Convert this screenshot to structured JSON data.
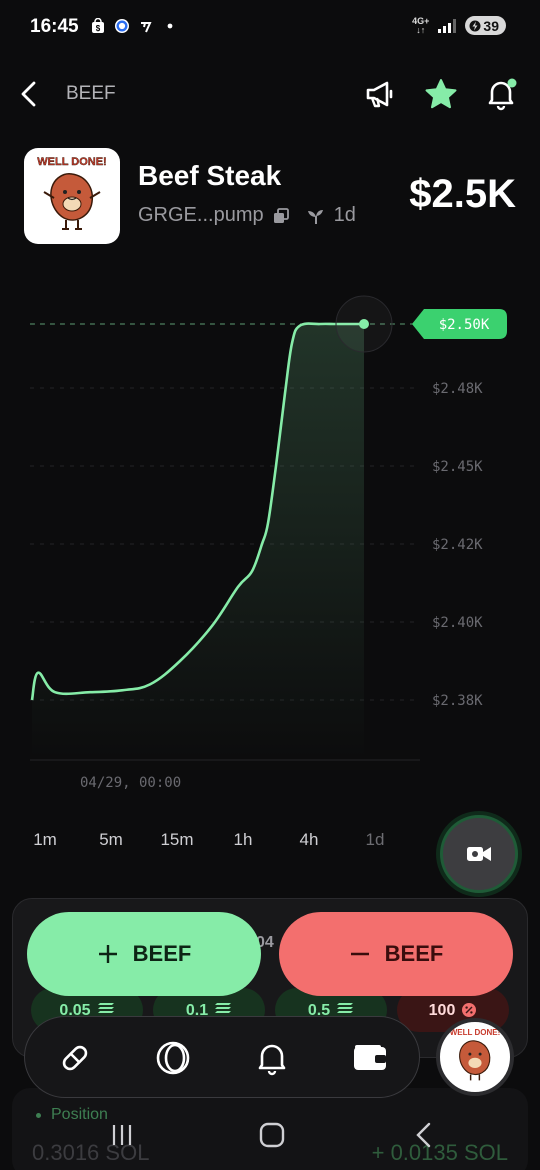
{
  "status_bar": {
    "time": "16:45",
    "network": "4G+",
    "battery": "39"
  },
  "header": {
    "ticker": "BEEF"
  },
  "token": {
    "name": "Beef Steak",
    "address": "GRGE...pump",
    "age": "1d",
    "price": "$2.5K",
    "logo_caption": "WELL DONE!"
  },
  "chart_data": {
    "type": "line",
    "y_ticks": [
      "$2.50K",
      "$2.48K",
      "$2.45K",
      "$2.42K",
      "$2.40K",
      "$2.38K"
    ],
    "x_ticks": [
      "04/29, 00:00"
    ],
    "current_label": "$2.50K",
    "x": [
      "t01",
      "t02",
      "t03",
      "t04",
      "t05",
      "t06",
      "t07",
      "t08",
      "t09",
      "t10",
      "t11",
      "t12",
      "t13",
      "t14",
      "t15",
      "t16",
      "t17",
      "t18",
      "t19",
      "t20",
      "t21",
      "t22"
    ],
    "values": [
      2380,
      2387,
      2382,
      2382,
      2382.5,
      2384,
      2390,
      2399,
      2409,
      2413,
      2420,
      2428,
      2450,
      2478,
      2494,
      2499.5,
      2500,
      2500,
      2500,
      2500,
      2500,
      2500
    ],
    "ylim": [
      2365,
      2510
    ],
    "color": "#86eca8"
  },
  "timeframes": [
    {
      "label": "1m"
    },
    {
      "label": "5m"
    },
    {
      "label": "15m"
    },
    {
      "label": "1h"
    },
    {
      "label": "4h"
    },
    {
      "label": "1d"
    }
  ],
  "trade": {
    "buy_label": "BEEF",
    "sell_label": "BEEF",
    "peek_text": "04",
    "buy_amounts": [
      "0.05",
      "0.1",
      "0.5"
    ],
    "sell_amount": "100"
  },
  "position": {
    "label": "Position",
    "amount": "0.3016 SOL",
    "pnl": "+ 0.0135 SOL"
  },
  "colors": {
    "accent_green": "#86eca8",
    "accent_red": "#f36f6e",
    "background": "#0c0c0d"
  }
}
